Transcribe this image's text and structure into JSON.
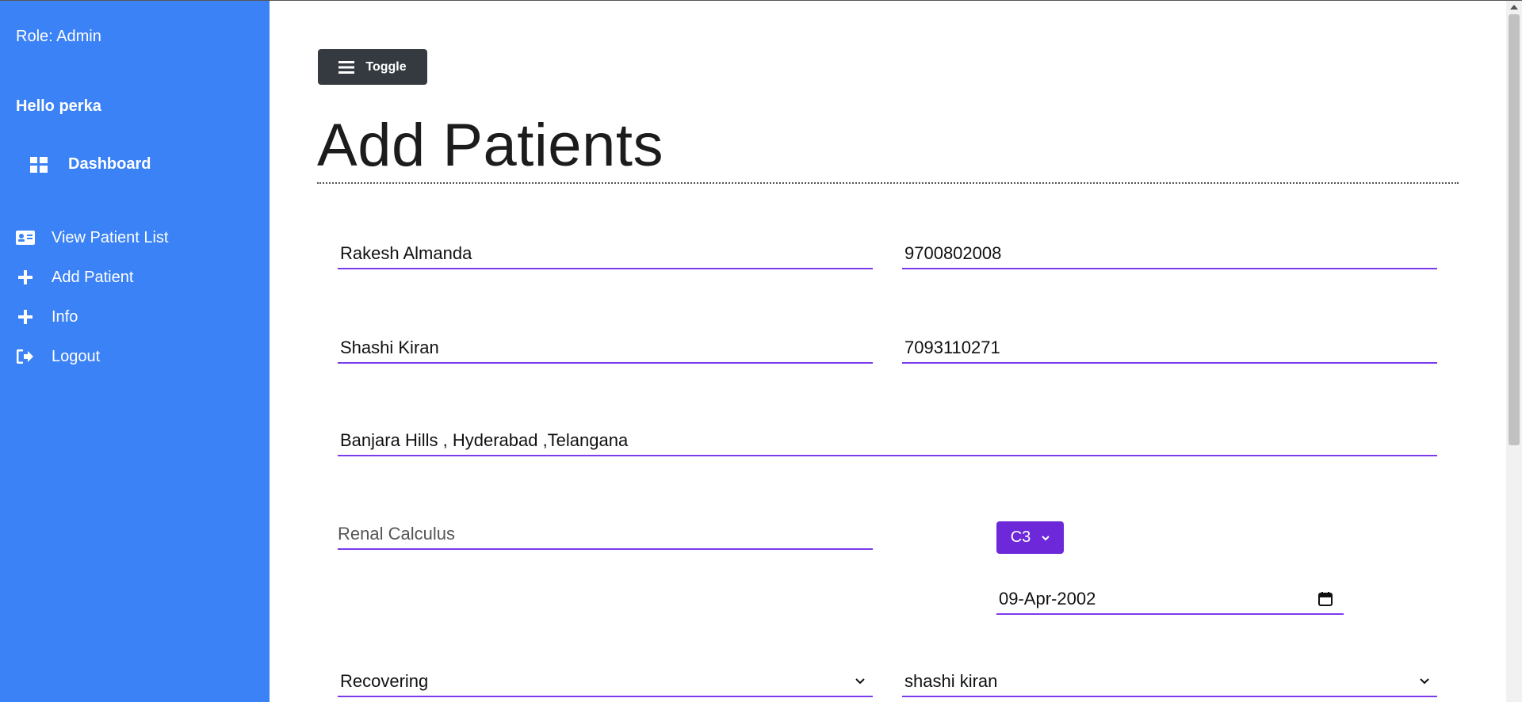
{
  "sidebar": {
    "role": "Role: Admin",
    "greeting": "Hello perka",
    "dashboard_label": "Dashboard",
    "items": [
      {
        "label": "View Patient List",
        "icon": "id-card-icon"
      },
      {
        "label": "Add Patient",
        "icon": "plus-icon"
      },
      {
        "label": "Info",
        "icon": "plus-icon"
      },
      {
        "label": "Logout",
        "icon": "logout-icon"
      }
    ],
    "background_color": "#3b82f6"
  },
  "main": {
    "toggle_label": "Toggle",
    "page_title": "Add Patients"
  },
  "form": {
    "patient_name": "Rakesh Almanda",
    "patient_phone": "9700802008",
    "guardian_name": "Shashi Kiran",
    "guardian_phone": "7093110271",
    "address": "Banjara Hills , Hyderabad ,Telangana",
    "disease_placeholder": "Renal Calculus",
    "category": "C3",
    "date": "09-Apr-2002",
    "status": "Recovering",
    "doctor": "shashi kiran"
  },
  "colors": {
    "accent": "#7c3aed",
    "category_button": "#6d28d9",
    "toggle_button": "#343a40"
  }
}
